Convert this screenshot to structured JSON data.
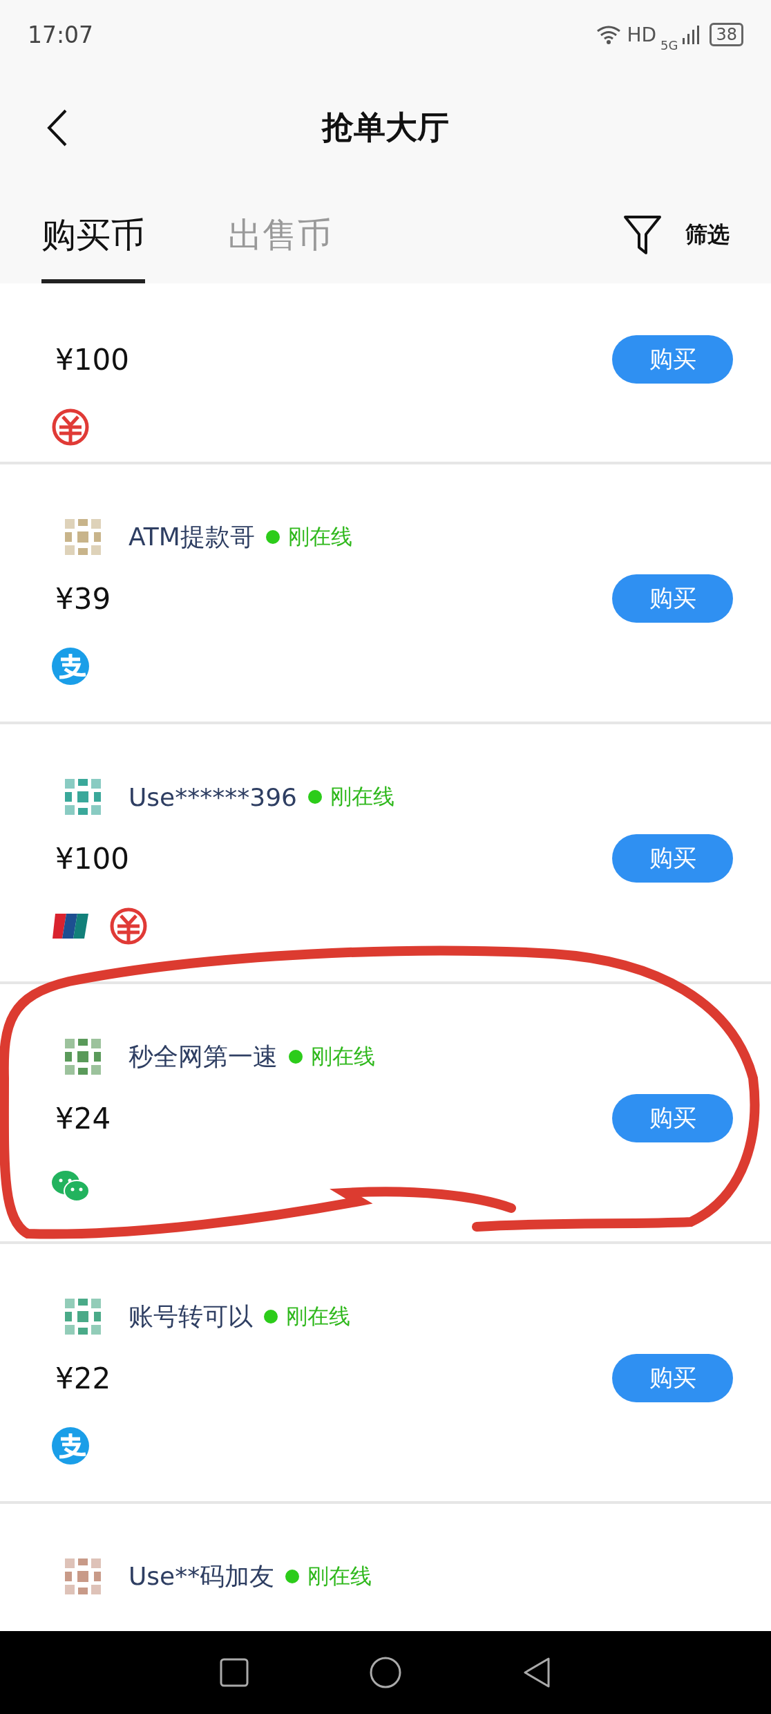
{
  "status_bar": {
    "time": "17:07",
    "network": "HD",
    "signal_type": "5G",
    "battery": "38"
  },
  "header": {
    "title": "抢单大厅"
  },
  "tabs": [
    {
      "label": "购买币",
      "selected": true
    },
    {
      "label": "出售币",
      "selected": false
    }
  ],
  "filter": {
    "label": "筛选"
  },
  "listings": [
    {
      "price": "¥100",
      "button": "购买",
      "payments": [
        {
          "kind": "digital_yuan"
        }
      ]
    },
    {
      "name": "ATM提款哥",
      "status": "刚在线",
      "price": "¥39",
      "button": "购买",
      "payments": [
        {
          "kind": "alipay"
        }
      ]
    },
    {
      "name": "Use******396",
      "status": "刚在线",
      "price": "¥100",
      "button": "购买",
      "payments": [
        {
          "kind": "unionpay"
        },
        {
          "kind": "digital_yuan"
        }
      ]
    },
    {
      "name": "秒全网第一速",
      "status": "刚在线",
      "price": "¥24",
      "button": "购买",
      "payments": [
        {
          "kind": "wechat"
        }
      ]
    },
    {
      "name": "账号转可以",
      "status": "刚在线",
      "price": "¥22",
      "button": "购买",
      "payments": [
        {
          "kind": "alipay"
        }
      ]
    },
    {
      "name": "Use**码加友",
      "status": "刚在线"
    }
  ]
}
